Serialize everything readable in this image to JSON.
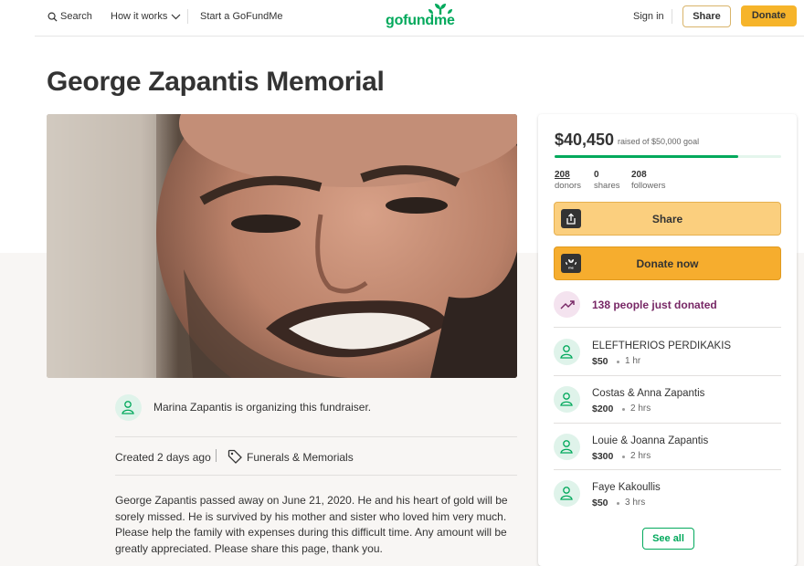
{
  "header": {
    "search_label": "Search",
    "how_label": "How it works",
    "start_label": "Start a GoFundMe",
    "logo_text": "gofundme",
    "signin_label": "Sign in",
    "share_label": "Share",
    "donate_label": "Donate",
    "brand_color": "#02a95c"
  },
  "campaign": {
    "title": "George Zapantis Memorial",
    "organizer_text": "Marina Zapantis is organizing this fundraiser.",
    "created_text": "Created 2 days ago",
    "category": "Funerals & Memorials",
    "story": "George Zapantis passed away on June 21, 2020. He and his heart of gold will be sorely missed. He is survived by his mother and sister who loved him very much. Please help the family with expenses during this difficult time. Any amount will be greatly appreciated. Please share this page, thank you."
  },
  "sidebar": {
    "raised": "$40,450",
    "goal_text": "raised of $50,000 goal",
    "progress_fraction": 0.809,
    "stats": [
      {
        "num": "208",
        "label": "donors"
      },
      {
        "num": "0",
        "label": "shares"
      },
      {
        "num": "208",
        "label": "followers"
      }
    ],
    "share_button": "Share",
    "donate_button": "Donate now",
    "just_donated": "138 people just donated",
    "donations": [
      {
        "name": "ELEFTHERIOS PERDIKAKIS",
        "amount": "$50",
        "time": "1 hr"
      },
      {
        "name": "Costas & Anna Zapantis",
        "amount": "$200",
        "time": "2 hrs"
      },
      {
        "name": "Louie & Joanna Zapantis",
        "amount": "$300",
        "time": "2 hrs"
      },
      {
        "name": "Faye Kakoullis",
        "amount": "$50",
        "time": "3 hrs"
      }
    ],
    "see_all": "See all"
  }
}
